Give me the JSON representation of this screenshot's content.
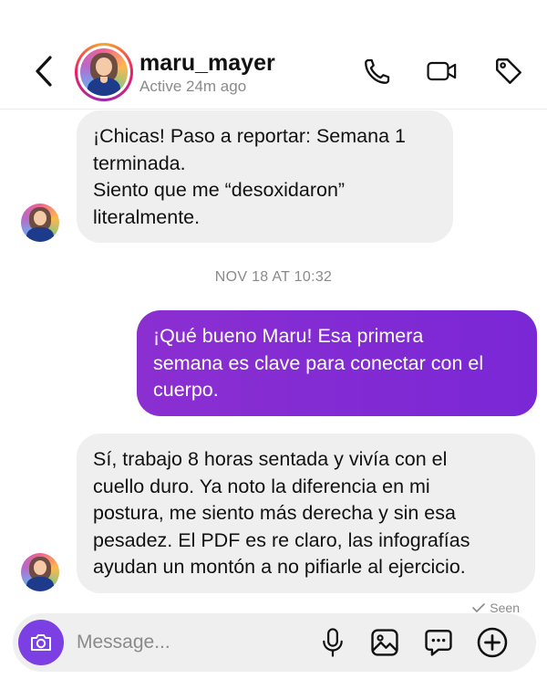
{
  "header": {
    "username": "maru_mayer",
    "status": "Active 24m ago"
  },
  "icons": {
    "back": "chevron-left-icon",
    "call": "phone-icon",
    "video": "video-camera-icon",
    "tag": "tag-icon",
    "camera": "camera-icon",
    "mic": "microphone-icon",
    "gallery": "image-icon",
    "sticker": "chat-bubble-icon",
    "add": "plus-circle-icon"
  },
  "messages": [
    {
      "sender": "maru_mayer",
      "direction": "incoming",
      "lines": [
        "¡Chicas! Paso a reportar: Semana 1",
        "terminada.",
        "Siento que me “desoxidaron”",
        "literalmente."
      ]
    },
    {
      "sender": "me",
      "direction": "outgoing",
      "lines": [
        "¡Qué bueno Maru! Esa primera",
        "semana es clave para conectar con el",
        "cuerpo."
      ]
    },
    {
      "sender": "maru_mayer",
      "direction": "incoming",
      "lines": [
        "Sí, trabajo 8 horas sentada y vivía con el",
        "cuello duro. Ya noto la diferencia en mi",
        "postura, me siento más derecha y sin esa",
        "pesadez. El PDF es re claro, las infografías",
        "ayudan un montón a no pifiarle al ejercicio."
      ]
    }
  ],
  "timestamp": "NOV 18 AT 10:32",
  "seen_label": "Seen",
  "composer": {
    "placeholder": "Message..."
  },
  "colors": {
    "outgoing_bubble": "#7a27d6",
    "incoming_bubble": "#efefef",
    "camera_button": "#7b3fe4",
    "secondary_text": "#8a8a8a"
  }
}
